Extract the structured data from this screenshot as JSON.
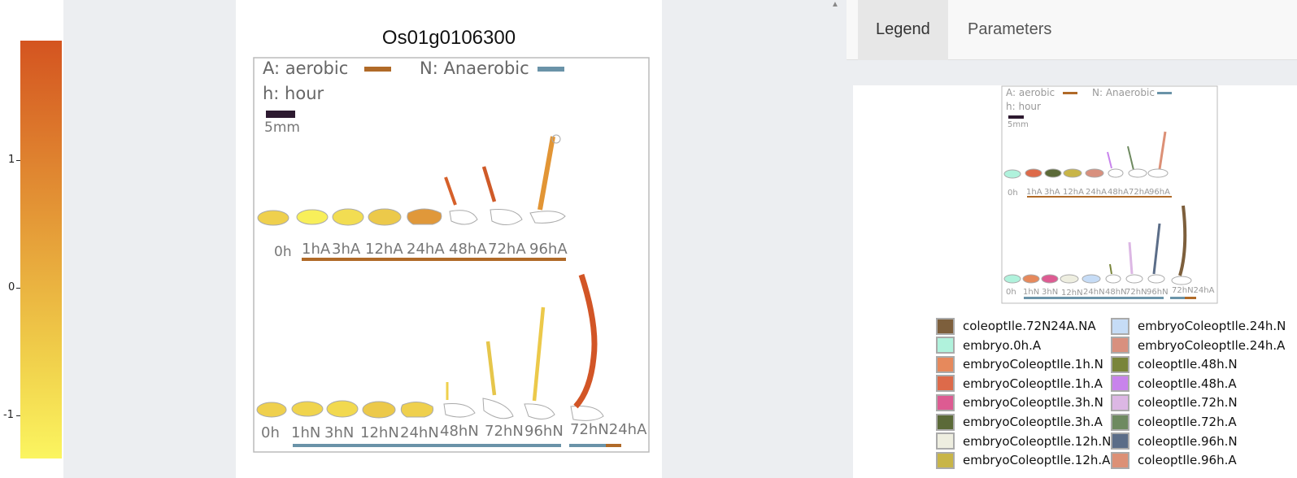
{
  "scale": {
    "ticks": [
      {
        "label": "1"
      },
      {
        "label": "0"
      },
      {
        "label": "-1"
      }
    ],
    "colors": {
      "high": "#d45420",
      "mid": "#e39435",
      "low": "#fbf560"
    }
  },
  "plot": {
    "title": "Os01g0106300",
    "legend_aerobic": "A: aerobic",
    "legend_anaerobic": "N: Anaerobic",
    "legend_hour": "h: hour",
    "scalebar": "5mm",
    "aerobic_labels": [
      "0h",
      "1hA",
      "3hA",
      "12hA",
      "24hA",
      "48hA",
      "72hA",
      "96hA"
    ],
    "anaerobic_labels": [
      "0h",
      "1hN",
      "3hN",
      "12hN",
      "24hN",
      "48hN",
      "72hN",
      "96hN",
      "72hN24hA"
    ],
    "aerobic_color": "#b06a28",
    "anaerobic_color": "#6a93a8"
  },
  "tabs": [
    {
      "label": "Legend",
      "active": true
    },
    {
      "label": "Parameters",
      "active": false
    }
  ],
  "mini": {
    "legend_aerobic": "A: aerobic",
    "legend_anaerobic": "N: Anaerobic",
    "legend_hour": "h: hour",
    "scalebar": "5mm",
    "aerobic_labels": [
      "0h",
      "1hA",
      "3hA",
      "12hA",
      "24hA",
      "48hA",
      "72hA",
      "96hA"
    ],
    "anaerobic_labels": [
      "0h",
      "1hN",
      "3hN",
      "12hN",
      "24hN",
      "48hN",
      "72hN",
      "96hN",
      "72hN24hA"
    ]
  },
  "legend_items": [
    {
      "label": "coleoptIle.72N24A.NA",
      "color": "#7d5f3c"
    },
    {
      "label": "embryo.0h.A",
      "color": "#b0f2dc"
    },
    {
      "label": "embryoColeoptIle.1h.N",
      "color": "#e6895c"
    },
    {
      "label": "embryoColeoptIle.1h.A",
      "color": "#dd6a4a"
    },
    {
      "label": "embryoColeoptIle.3h.N",
      "color": "#dd5b92"
    },
    {
      "label": "embryoColeoptIle.3h.A",
      "color": "#5b6a38"
    },
    {
      "label": "embryoColeoptIle.12h.N",
      "color": "#eeeee0"
    },
    {
      "label": "embryoColeoptIle.12h.A",
      "color": "#c8b548"
    },
    {
      "label": "embryoColeoptIle.24h.N",
      "color": "#c6dcf6"
    },
    {
      "label": "embryoColeoptIle.24h.A",
      "color": "#d8907e"
    },
    {
      "label": "coleoptIle.48h.N",
      "color": "#79853a"
    },
    {
      "label": "coleoptIle.48h.A",
      "color": "#c883ec"
    },
    {
      "label": "coleoptIle.72h.N",
      "color": "#dcb7e4"
    },
    {
      "label": "coleoptIle.72h.A",
      "color": "#6e8a60"
    },
    {
      "label": "coleoptIle.96h.N",
      "color": "#5b6d88"
    },
    {
      "label": "coleoptIle.96h.A",
      "color": "#dc9076"
    }
  ]
}
